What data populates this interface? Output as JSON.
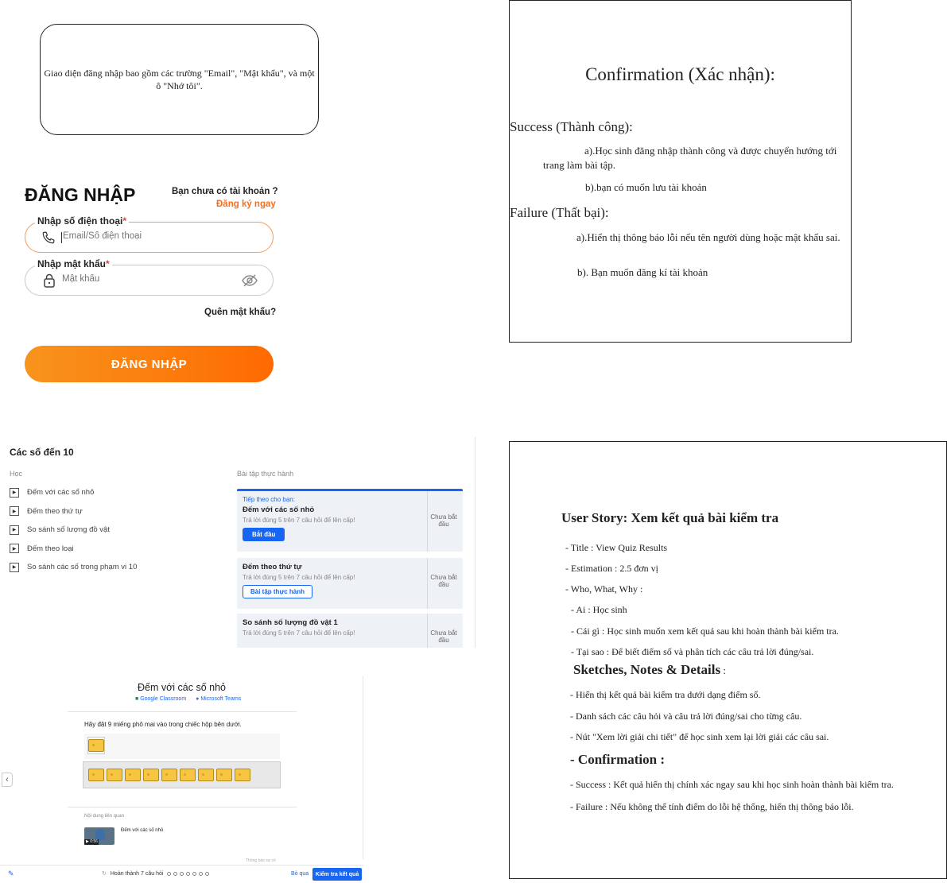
{
  "note": {
    "text": "Giao diện đăng nhập bao gồm các trường \"Email\", \"Mật khẩu\", và một ô \"Nhớ tôi\"."
  },
  "login": {
    "title": "ĐĂNG NHẬP",
    "no_account": "Bạn chưa có tài khoản ?",
    "register_link": "Đăng ký ngay",
    "phone_label": "Nhập số điện thoại",
    "phone_placeholder": "Email/Số điện thoại",
    "password_label": "Nhập mật khẩu",
    "password_placeholder": "Mật khẩu",
    "required_mark": "*",
    "forgot": "Quên mật khẩu?",
    "submit": "ĐĂNG NHẬP",
    "accent": "#f37021"
  },
  "confirmation": {
    "heading": "Confirmation (Xác nhận):",
    "success_title": "Success (Thành công):",
    "success_a": "a).Học sinh đăng nhập thành công và được chuyển hướng tới trang làm bài tập.",
    "success_b": "b).bạn có muốn lưu tài khoản",
    "failure_title": "Failure (Thất bại):",
    "failure_a": "a).Hiển thị thông báo lỗi nếu tên người dùng hoặc mật khẩu sai.",
    "failure_b": "b). Bạn muốn đăng kí tài khoản"
  },
  "course": {
    "title": "Các số đến 10",
    "learn_header": "Học",
    "practice_header": "Bài tập thực hành",
    "lessons": [
      "Đếm với các số nhỏ",
      "Đếm theo thứ tự",
      "So sánh số lượng đồ vật",
      "Đếm theo loại",
      "So sánh các số trong phạm vi 10"
    ],
    "cards": [
      {
        "eyebrow": "Tiếp theo cho bạn:",
        "title": "Đếm với các số nhỏ",
        "sub": "Trả lời đúng 5 trên 7 câu hỏi để lên cấp!",
        "button": "Bắt đầu",
        "status": "Chưa bắt đầu"
      },
      {
        "title": "Đếm theo thứ tự",
        "sub": "Trả lời đúng 5 trên 7 câu hỏi để lên cấp!",
        "button": "Bài tập thực hành",
        "status": "Chưa bắt đầu"
      },
      {
        "title": "So sánh số lượng đồ vật 1",
        "sub": "Trả lời đúng 5 trên 7 câu hỏi để lên cấp!",
        "status": "Chưa bắt đầu"
      }
    ]
  },
  "quiz": {
    "title": "Đếm với các số nhỏ",
    "share_google": "Google Classroom",
    "share_teams": "Microsoft Teams",
    "question": "Hãy đặt 9 miếng phô mai vào trong chiếc hộp bên dưới.",
    "cheese_count": 9,
    "related_header": "Nội dung liên quan",
    "related_item": "Đếm với các số nhỏ",
    "video_time": "0:56",
    "report": "Thông báo sự cố",
    "progress": "Hoàn thành 7 câu hỏi",
    "total_questions": 7,
    "skip": "Bỏ qua",
    "check": "Kiểm tra kết quả",
    "primary_color": "#1865f2"
  },
  "user_story": {
    "title": "User Story: Xem kết quả bài kiểm tra",
    "lines": [
      "-  Title : View Quiz Results",
      "-  Estimation : 2.5 đơn vị",
      "-  Who, What, Why :"
    ],
    "www": [
      "-  Ai : Học sinh",
      "-  Cái gì : Học sinh muốn xem kết quả sau khi hoàn thành bài kiểm tra.",
      "-  Tại sao : Để biết điểm số và phân tích các câu trả lời đúng/sai."
    ],
    "sketches_title": "Sketches, Notes & Details",
    "sketches_colon": " :",
    "sketches": [
      "- Hiển thị kết quả bài kiểm tra dưới dạng điểm số.",
      "- Danh sách các câu hỏi và câu trả lời đúng/sai cho từng câu.",
      "- Nút \"Xem lời giải chi tiết\" để học sinh xem lại lời giải các câu sai."
    ],
    "confirm_title": "-  Confirmation :",
    "confirm": [
      "-  Success : Kết quả hiển thị chính xác ngay sau khi học sinh hoàn thành bài kiểm tra.",
      "-  Failure : Nếu không thể tính điểm do lỗi hệ thống, hiển thị thông báo lỗi."
    ]
  }
}
